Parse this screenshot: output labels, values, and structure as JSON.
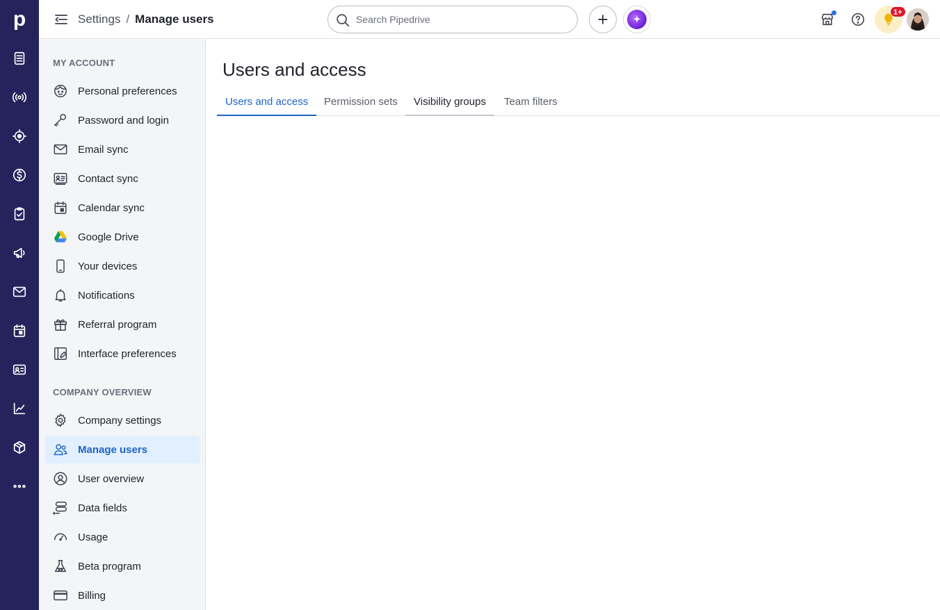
{
  "rail": {
    "logo": "p",
    "items": [
      {
        "icon": "leads-inbox-icon"
      },
      {
        "icon": "campaigns-broadcast-icon"
      },
      {
        "icon": "focus-target-icon"
      },
      {
        "icon": "deals-dollar-icon"
      },
      {
        "icon": "activities-clipboard-icon"
      },
      {
        "icon": "megaphone-icon"
      },
      {
        "icon": "mail-icon"
      },
      {
        "icon": "calendar-icon"
      },
      {
        "icon": "contacts-card-icon"
      },
      {
        "icon": "insights-chart-icon"
      },
      {
        "icon": "products-box-icon"
      },
      {
        "icon": "more-dots-icon"
      }
    ]
  },
  "header": {
    "breadcrumb_parent": "Settings",
    "breadcrumb_separator": "/",
    "breadcrumb_current": "Manage users",
    "search_placeholder": "Search Pipedrive",
    "tips_badge": "1+"
  },
  "sidebar": {
    "my_account_title": "MY ACCOUNT",
    "my_account_items": [
      {
        "label": "Personal preferences",
        "icon": "face-icon"
      },
      {
        "label": "Password and login",
        "icon": "key-icon"
      },
      {
        "label": "Email sync",
        "icon": "envelope-icon"
      },
      {
        "label": "Contact sync",
        "icon": "contact-card-icon"
      },
      {
        "label": "Calendar sync",
        "icon": "calendar-icon"
      },
      {
        "label": "Google Drive",
        "icon": "google-drive-icon"
      },
      {
        "label": "Your devices",
        "icon": "phone-icon"
      },
      {
        "label": "Notifications",
        "icon": "bell-icon"
      },
      {
        "label": "Referral program",
        "icon": "gift-icon"
      },
      {
        "label": "Interface preferences",
        "icon": "interface-edit-icon"
      }
    ],
    "company_title": "COMPANY OVERVIEW",
    "company_items": [
      {
        "label": "Company settings",
        "icon": "gear-icon"
      },
      {
        "label": "Manage users",
        "icon": "users-icon",
        "active": true
      },
      {
        "label": "User overview",
        "icon": "user-circle-icon"
      },
      {
        "label": "Data fields",
        "icon": "data-fields-icon"
      },
      {
        "label": "Usage",
        "icon": "gauge-icon"
      },
      {
        "label": "Beta program",
        "icon": "flask-icon"
      },
      {
        "label": "Billing",
        "icon": "credit-card-icon"
      }
    ]
  },
  "main": {
    "title": "Users and access",
    "tabs": [
      {
        "label": "Users and access",
        "state": "active"
      },
      {
        "label": "Permission sets",
        "state": "normal"
      },
      {
        "label": "Visibility groups",
        "state": "hover"
      },
      {
        "label": "Team filters",
        "state": "normal"
      }
    ]
  },
  "colors": {
    "rail_bg": "#26235c",
    "accent": "#1f64c4",
    "active_bg": "#e2efff",
    "sidebar_bg": "#f4f5f7"
  }
}
